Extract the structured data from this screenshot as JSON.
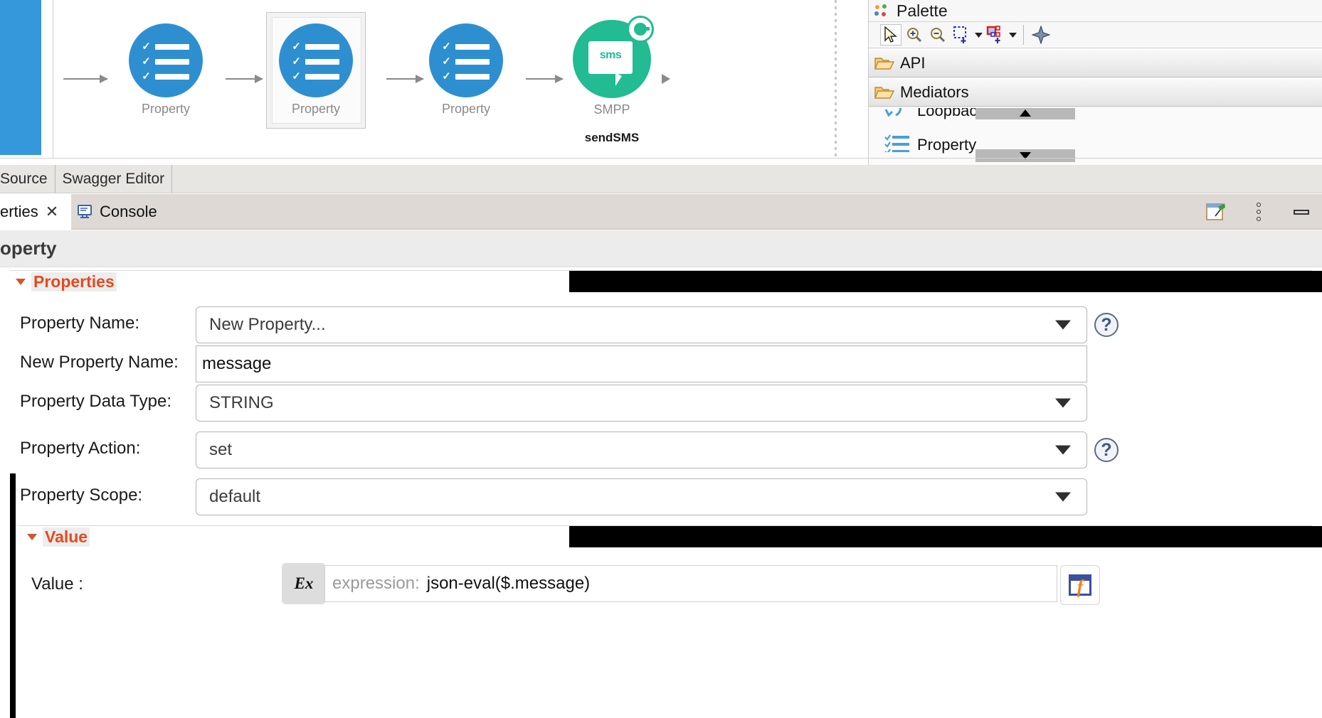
{
  "canvas": {
    "nodes": [
      {
        "label": "Property",
        "type": "property-mediator"
      },
      {
        "label": "Property",
        "type": "property-mediator",
        "selected": true
      },
      {
        "label": "Property",
        "type": "property-mediator"
      },
      {
        "label": "SMPP",
        "sublabel": "sendSMS",
        "type": "smpp-connector",
        "icon_text": "sms"
      }
    ],
    "accent_blue": "#2e8fd0",
    "accent_green": "#22bb92",
    "rail_color": "#3498db"
  },
  "palette": {
    "title": "Palette",
    "tools": [
      {
        "name": "select-tool",
        "label": "Select"
      },
      {
        "name": "zoom-in-tool",
        "label": "Zoom In"
      },
      {
        "name": "zoom-out-tool",
        "label": "Zoom Out"
      },
      {
        "name": "marquee-tool",
        "label": "Marquee"
      },
      {
        "name": "connection-tool",
        "label": "Connection"
      },
      {
        "name": "arrange-tool",
        "label": "Arrange All"
      }
    ],
    "drawers": [
      {
        "label": "API"
      },
      {
        "label": "Mediators"
      }
    ],
    "items": [
      {
        "label": "Loopback"
      },
      {
        "label": "Property"
      }
    ]
  },
  "editor_tabs": [
    {
      "label": "Source",
      "active": false
    },
    {
      "label": "Swagger Editor",
      "active": false
    }
  ],
  "view_tabs": [
    {
      "label": "erties",
      "active": true,
      "close": "✕"
    },
    {
      "label": "Console",
      "active": false
    }
  ],
  "view_tools": [
    {
      "name": "pin-view-button"
    },
    {
      "name": "view-menu-button"
    },
    {
      "name": "minimize-button"
    }
  ],
  "properties_view": {
    "title": "operty",
    "sections": [
      {
        "id": "properties",
        "title": "Properties"
      },
      {
        "id": "value",
        "title": "Value"
      }
    ],
    "fields": [
      {
        "label": "Property Name:",
        "value": "New Property...",
        "control": "combo",
        "help": "?"
      },
      {
        "label": "New Property Name:",
        "value": "message",
        "control": "text"
      },
      {
        "label": "Property Data Type:",
        "value": "STRING",
        "control": "combo"
      },
      {
        "label": "Property Action:",
        "value": "set",
        "control": "combo",
        "help": "?"
      },
      {
        "label": "Property Scope:",
        "value": "default",
        "control": "combo"
      }
    ],
    "value_field": {
      "label": "Value :",
      "toggle_label": "Ex",
      "prefix": "expression:",
      "expression": "json-eval($.message)",
      "fx_label": "f"
    }
  },
  "colors": {
    "section_orange": "#e8491d",
    "help_blue": "#3f5680",
    "fx_orange": "#f08020",
    "fx_blue": "#3a4fa0"
  }
}
